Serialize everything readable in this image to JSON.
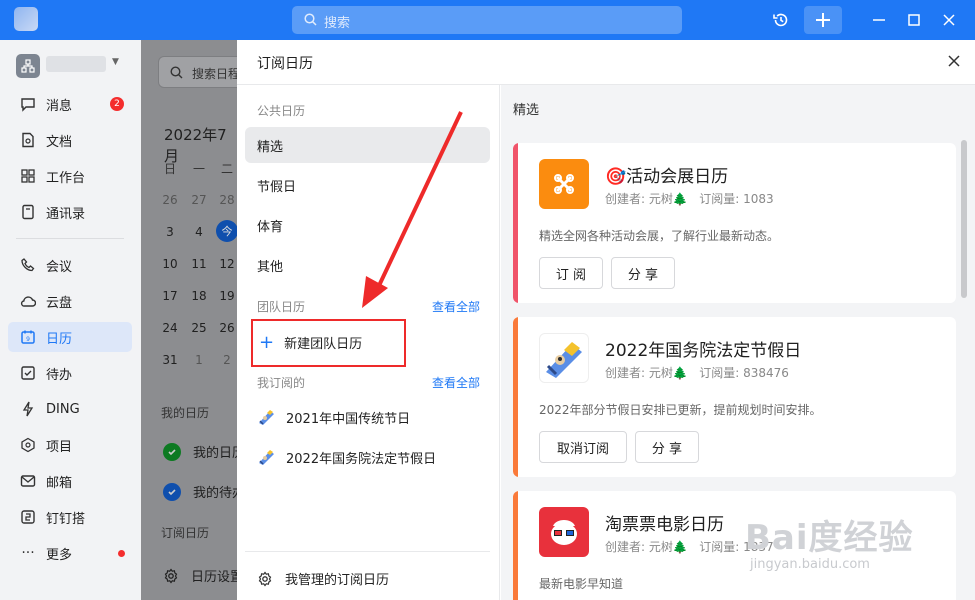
{
  "topbar": {
    "search_placeholder": "搜索",
    "colors": {
      "bar": "#1f78f5"
    }
  },
  "sidebar": {
    "items": [
      {
        "label": "消息",
        "icon": "message-icon",
        "badge": "2"
      },
      {
        "label": "文档",
        "icon": "document-icon"
      },
      {
        "label": "工作台",
        "icon": "workbench-icon"
      },
      {
        "label": "通讯录",
        "icon": "contacts-icon"
      },
      {
        "label": "会议",
        "icon": "phone-icon"
      },
      {
        "label": "云盘",
        "icon": "cloud-icon"
      },
      {
        "label": "日历",
        "icon": "calendar-icon",
        "active": true
      },
      {
        "label": "待办",
        "icon": "todo-icon"
      },
      {
        "label": "DING",
        "icon": "lightning-icon"
      },
      {
        "label": "项目",
        "icon": "project-icon"
      },
      {
        "label": "邮箱",
        "icon": "mail-icon"
      },
      {
        "label": "钉钉搭",
        "icon": "build-icon"
      },
      {
        "label": "更多",
        "icon": "more-icon",
        "dot": true
      }
    ]
  },
  "calendar": {
    "search_placeholder": "搜索日程",
    "month_title": "2022年7月",
    "weekdays": [
      "日",
      "一",
      "二"
    ],
    "weeks": [
      [
        "26",
        "27",
        "28"
      ],
      [
        "3",
        "4",
        "今"
      ],
      [
        "10",
        "11",
        "12"
      ],
      [
        "17",
        "18",
        "19"
      ],
      [
        "24",
        "25",
        "26"
      ],
      [
        "31",
        "1",
        "2"
      ]
    ],
    "my_calendars_label": "我的日历",
    "my_calendars": [
      "我的日历",
      "我的待办"
    ],
    "subscribed_label": "订阅日历",
    "settings_label": "日历设置"
  },
  "panel": {
    "title": "订阅日历",
    "public_label": "公共日历",
    "public_items": [
      "精选",
      "节假日",
      "体育",
      "其他"
    ],
    "team_label": "团队日历",
    "view_all": "查看全部",
    "new_team": "新建团队日历",
    "subscribed_label": "我订阅的",
    "subscribed_items": [
      "2021年中国传统节日",
      "2022年国务院法定节假日"
    ],
    "managed": "我管理的订阅日历",
    "right_title": "精选",
    "cards": [
      {
        "name": "🎯活动会展日历",
        "creator": "创建者: 元树🌲",
        "subs": "订阅量: 1083",
        "desc": "精选全网各种活动会展，了解行业最新动态。",
        "buttons": [
          "订 阅",
          "分 享"
        ],
        "accent": "#f0546a",
        "icon": "event-icon"
      },
      {
        "name": "2022年国务院法定节假日",
        "creator": "创建者: 元树🌲",
        "subs": "订阅量: 838476",
        "desc": "2022年部分节假日安排已更新，提前规划时间安排。",
        "buttons": [
          "取消订阅",
          "分 享"
        ],
        "accent": "#fa7a3a",
        "icon": "holiday-icon"
      },
      {
        "name": "淘票票电影日历",
        "creator": "创建者: 元树🌲",
        "subs": "订阅量: 1837",
        "desc": "最新电影早知道",
        "buttons": [],
        "accent": "#fa7a3a",
        "icon": "movie-icon"
      }
    ]
  },
  "watermark": {
    "main": "Bai度经验",
    "sub": "jingyan.baidu.com"
  }
}
